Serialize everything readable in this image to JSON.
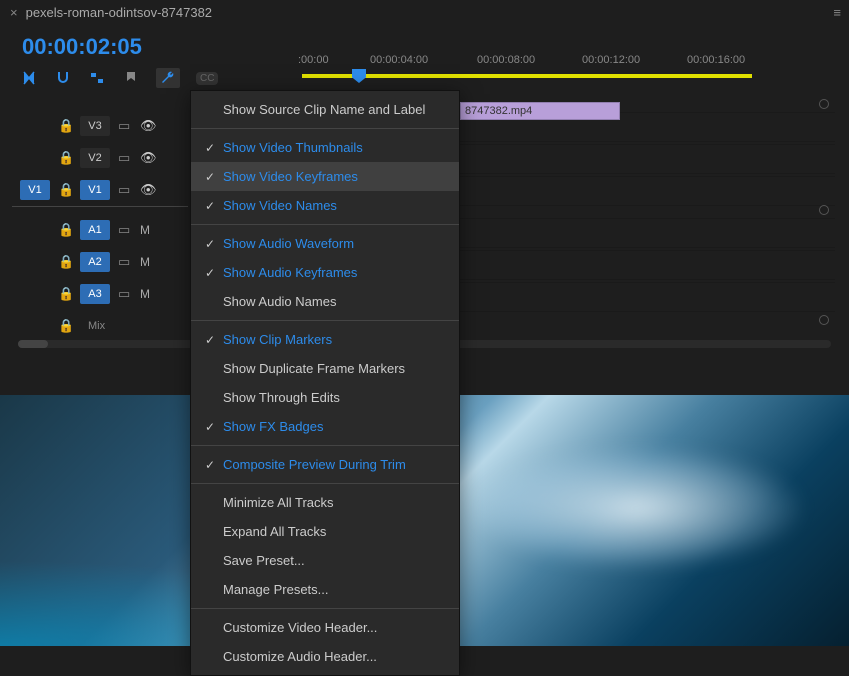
{
  "titlebar": {
    "close": "×",
    "name": "pexels-roman-odintsov-8747382",
    "hamburger": "≡"
  },
  "timecode": "00:00:02:05",
  "ruler": {
    "t0": ":00:00",
    "t1": "00:00:04:00",
    "t2": "00:00:08:00",
    "t3": "00:00:12:00",
    "t4": "00:00:16:00"
  },
  "tracks": {
    "v3": "V3",
    "v2": "V2",
    "v1": "V1",
    "a1": "A1",
    "a2": "A2",
    "a3": "A3",
    "mix": "Mix",
    "src_v1": "V1",
    "m": "M"
  },
  "clip": "8747382.mp4",
  "menu": {
    "items": [
      {
        "label": "Show Source Clip Name and Label",
        "checked": false,
        "active": false,
        "hl": false
      },
      {
        "sep": true
      },
      {
        "label": "Show Video Thumbnails",
        "checked": true,
        "active": true,
        "hl": false
      },
      {
        "label": "Show Video Keyframes",
        "checked": true,
        "active": true,
        "hl": true
      },
      {
        "label": "Show Video Names",
        "checked": true,
        "active": true,
        "hl": false
      },
      {
        "sep": true
      },
      {
        "label": "Show Audio Waveform",
        "checked": true,
        "active": true,
        "hl": false
      },
      {
        "label": "Show Audio Keyframes",
        "checked": true,
        "active": true,
        "hl": false
      },
      {
        "label": "Show Audio Names",
        "checked": false,
        "active": false,
        "hl": false
      },
      {
        "sep": true
      },
      {
        "label": "Show Clip Markers",
        "checked": true,
        "active": true,
        "hl": false
      },
      {
        "label": "Show Duplicate Frame Markers",
        "checked": false,
        "active": false,
        "hl": false
      },
      {
        "label": "Show Through Edits",
        "checked": false,
        "active": false,
        "hl": false
      },
      {
        "label": "Show FX Badges",
        "checked": true,
        "active": true,
        "hl": false
      },
      {
        "sep": true
      },
      {
        "label": "Composite Preview During Trim",
        "checked": true,
        "active": true,
        "hl": false
      },
      {
        "sep": true
      },
      {
        "label": "Minimize All Tracks",
        "checked": false,
        "active": false,
        "hl": false
      },
      {
        "label": "Expand All Tracks",
        "checked": false,
        "active": false,
        "hl": false
      },
      {
        "label": "Save Preset...",
        "checked": false,
        "active": false,
        "hl": false
      },
      {
        "label": "Manage Presets...",
        "checked": false,
        "active": false,
        "hl": false
      },
      {
        "sep": true
      },
      {
        "label": "Customize Video Header...",
        "checked": false,
        "active": false,
        "hl": false
      },
      {
        "label": "Customize Audio Header...",
        "checked": false,
        "active": false,
        "hl": false
      }
    ]
  }
}
